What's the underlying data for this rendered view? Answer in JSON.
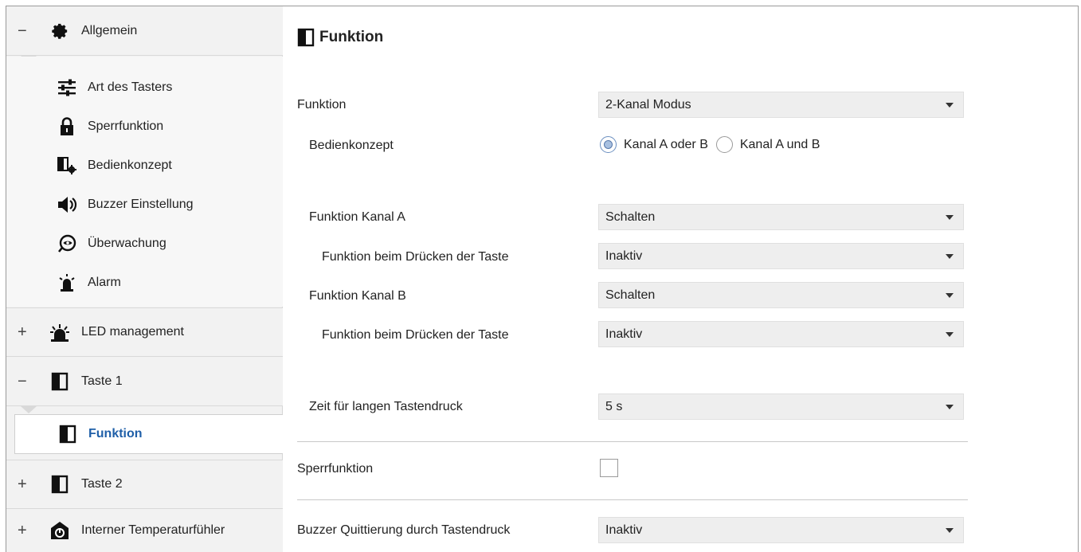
{
  "sidebar": {
    "allgemein": {
      "toggle": "−",
      "label": "Allgemein",
      "icon": "gear-icon"
    },
    "items": [
      {
        "label": "Art des Tasters",
        "icon": "sliders-icon"
      },
      {
        "label": "Sperrfunktion",
        "icon": "lock-icon"
      },
      {
        "label": "Bedienkonzept",
        "icon": "panel-gear-icon"
      },
      {
        "label": "Buzzer Einstellung",
        "icon": "speaker-icon"
      },
      {
        "label": "Überwachung",
        "icon": "eye-icon"
      },
      {
        "label": "Alarm",
        "icon": "alarm-bell-icon"
      }
    ],
    "led": {
      "toggle": "+",
      "label": "LED management",
      "icon": "led-icon"
    },
    "taste1": {
      "toggle": "−",
      "label": "Taste 1",
      "icon": "button-panel-icon"
    },
    "taste1_selected": {
      "label": "Funktion",
      "icon": "button-panel-icon"
    },
    "taste2": {
      "toggle": "+",
      "label": "Taste 2",
      "icon": "button-panel-icon"
    },
    "temp": {
      "toggle": "+",
      "label": "Interner Temperaturfühler",
      "icon": "thermometer-icon"
    }
  },
  "main": {
    "title": "Funktion",
    "funktion": {
      "label": "Funktion",
      "value": "2-Kanal Modus"
    },
    "bedienkonzept": {
      "label": "Bedienkonzept",
      "options": [
        "Kanal A oder B",
        "Kanal A und B"
      ],
      "selected": "Kanal A oder B"
    },
    "kanal_a": {
      "label": "Funktion Kanal A",
      "value": "Schalten"
    },
    "kanal_a_press": {
      "label": "Funktion beim Drücken der Taste",
      "value": "Inaktiv"
    },
    "kanal_b": {
      "label": "Funktion Kanal B",
      "value": "Schalten"
    },
    "kanal_b_press": {
      "label": "Funktion beim Drücken der Taste",
      "value": "Inaktiv"
    },
    "long_press": {
      "label": "Zeit für langen Tastendruck",
      "value": "5 s"
    },
    "sperrfunktion": {
      "label": "Sperrfunktion",
      "checked": false
    },
    "buzzer": {
      "label": "Buzzer Quittierung durch Tastendruck",
      "value": "Inaktiv"
    }
  },
  "colors": {
    "selected_text": "#1f5fa8",
    "sidebar_bg": "#f2f2f2",
    "dropdown_bg": "#eeeeee"
  }
}
